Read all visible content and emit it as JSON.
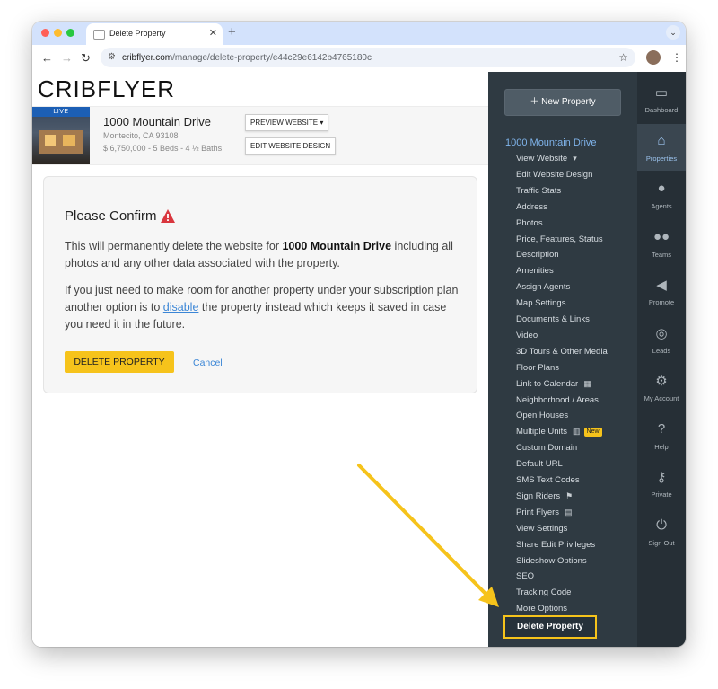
{
  "browser": {
    "tab_title": "Delete Property",
    "url_domain": "cribflyer.com",
    "url_path": "/manage/delete-property/e44c29e6142b4765180c"
  },
  "brand": {
    "logo": "CRIBFLYER"
  },
  "property": {
    "live_badge": "LIVE",
    "address": "1000 Mountain Drive",
    "city": "Montecito, CA 93108",
    "details": "$ 6,750,000 - 5 Beds - 4 ½ Baths",
    "preview_button": "PREVIEW WEBSITE ▾",
    "edit_design_button": "EDIT WEBSITE DESIGN"
  },
  "confirm": {
    "title": "Please Confirm",
    "para1_pre": "This will permanently delete the website for ",
    "para1_bold": "1000 Mountain Drive",
    "para1_post": " including all photos and any other data associated with the property.",
    "para2_pre": "If you just need to make room for another property under your subscription plan another option is to ",
    "para2_link": "disable",
    "para2_post": " the property instead which keeps it saved in case you need it in the future.",
    "delete_button": "DELETE PROPERTY",
    "cancel_link": "Cancel"
  },
  "sidebar": {
    "new_property": "New Property",
    "property_heading": "1000 Mountain Drive",
    "items": [
      {
        "label": "View Website",
        "icon": "▾"
      },
      {
        "label": "Edit Website Design"
      },
      {
        "label": "Traffic Stats"
      },
      {
        "label": "Address"
      },
      {
        "label": "Photos"
      },
      {
        "label": "Price, Features, Status"
      },
      {
        "label": "Description"
      },
      {
        "label": "Amenities"
      },
      {
        "label": "Assign Agents"
      },
      {
        "label": "Map Settings"
      },
      {
        "label": "Documents & Links"
      },
      {
        "label": "Video"
      },
      {
        "label": "3D Tours & Other Media"
      },
      {
        "label": "Floor Plans"
      },
      {
        "label": "Link to Calendar",
        "icon": "▦"
      },
      {
        "label": "Neighborhood / Areas"
      },
      {
        "label": "Open Houses"
      },
      {
        "label": "Multiple Units",
        "icon": "▥",
        "badge": "New"
      },
      {
        "label": "Custom Domain"
      },
      {
        "label": "Default URL"
      },
      {
        "label": "SMS Text Codes"
      },
      {
        "label": "Sign Riders",
        "icon": "⚑"
      },
      {
        "label": "Print Flyers",
        "icon": "▤"
      },
      {
        "label": "View Settings"
      },
      {
        "label": "Share Edit Privileges"
      },
      {
        "label": "Slideshow Options"
      },
      {
        "label": "SEO"
      },
      {
        "label": "Tracking Code"
      },
      {
        "label": "More Options"
      }
    ],
    "delete_property": "Delete Property"
  },
  "iconbar": [
    {
      "label": "Dashboard",
      "icon": "dashboard-icon",
      "glyph": "▭"
    },
    {
      "label": "Properties",
      "icon": "properties-icon",
      "glyph": "⌂",
      "active": true
    },
    {
      "label": "Agents",
      "icon": "agent-icon",
      "glyph": "●"
    },
    {
      "label": "Teams",
      "icon": "teams-icon",
      "glyph": "●●"
    },
    {
      "label": "Promote",
      "icon": "megaphone-icon",
      "glyph": "◀"
    },
    {
      "label": "Leads",
      "icon": "target-icon",
      "glyph": "◎"
    },
    {
      "label": "My Account",
      "icon": "gear-icon",
      "glyph": "⚙"
    },
    {
      "label": "Help",
      "icon": "help-icon",
      "glyph": "?"
    },
    {
      "label": "Private",
      "icon": "key-icon",
      "glyph": "⚷"
    },
    {
      "label": "Sign Out",
      "icon": "power-icon",
      "glyph": "⏻"
    }
  ],
  "colors": {
    "accent": "#f6c31b",
    "sidebar": "#2f3a42",
    "link": "#3b86d6"
  }
}
